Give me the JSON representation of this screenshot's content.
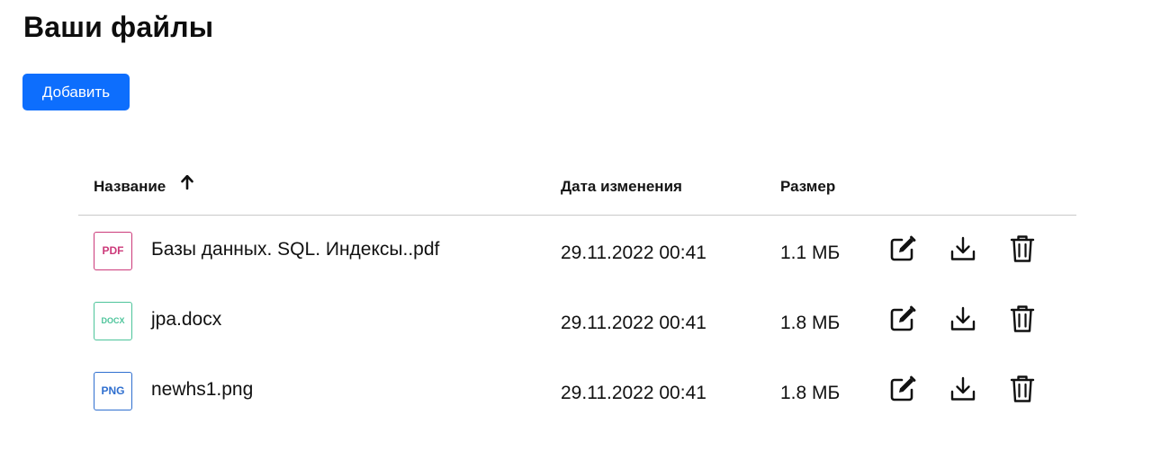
{
  "page": {
    "title": "Ваши файлы",
    "add_button_label": "Добавить"
  },
  "table": {
    "columns": {
      "name": "Название",
      "modified": "Дата изменения",
      "size": "Размер"
    },
    "sort": {
      "column": "name",
      "direction": "ascending",
      "icon": "arrow-up-icon"
    },
    "rows": [
      {
        "type_label": "PDF",
        "type_color": "#cc3a7a",
        "name": "Базы данных. SQL. Индексы..pdf",
        "modified": "29.11.2022 00:41",
        "size": "1.1 МБ"
      },
      {
        "type_label": "DOCX",
        "type_color": "#4cc49a",
        "name": "jpa.docx",
        "modified": "29.11.2022 00:41",
        "size": "1.8 МБ"
      },
      {
        "type_label": "PNG",
        "type_color": "#2f6fcf",
        "name": "newhs1.png",
        "modified": "29.11.2022 00:41",
        "size": "1.8 МБ"
      }
    ],
    "row_actions": [
      "edit-icon",
      "download-icon",
      "trash-icon"
    ]
  },
  "colors": {
    "accent": "#0d6efd",
    "divider": "#c9c9c9"
  }
}
